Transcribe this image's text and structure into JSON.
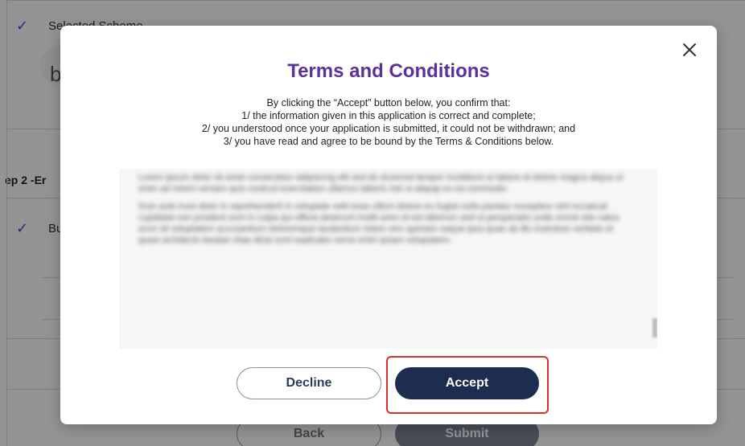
{
  "background": {
    "selected_scheme_label": "Selected Scheme",
    "logo_letter": "b",
    "step_title": "ep 2 -Er",
    "row_label": "Bu",
    "back_label": "Back",
    "submit_label": "Submit"
  },
  "modal": {
    "title": "Terms and Conditions",
    "intro_lines": [
      "By clicking the “Accept” button below, you confirm that:",
      "1/ the information given in this application is correct and complete;",
      "2/ you understood once your application is submitted, it could not be withdrawn; and",
      "3/ you have read and agree to be bound by the Terms & Conditions below."
    ],
    "terms_paragraphs": [
      "Lorem ipsum dolor sit amet consectetur adipiscing elit sed do eiusmod tempor incididunt ut labore et dolore magna aliqua ut enim ad minim veniam quis nostrud exercitation ullamco laboris nisi ut aliquip ex ea commodo.",
      "Duis aute irure dolor in reprehenderit in voluptate velit esse cillum dolore eu fugiat nulla pariatur excepteur sint occaecat cupidatat non proident sunt in culpa qui officia deserunt mollit anim id est laborum sed ut perspiciatis unde omnis iste natus error sit voluptatem accusantium doloremque laudantium totam rem aperiam eaque ipsa quae ab illo inventore veritatis et quasi architecto beatae vitae dicta sunt explicabo nemo enim ipsam voluptatem."
    ],
    "decline_label": "Decline",
    "accept_label": "Accept"
  },
  "colors": {
    "title": "#5b2f9e",
    "accept_bg": "#1d2d4f",
    "highlight": "#d9302b",
    "check": "#5b3fc1"
  },
  "icons": {
    "close": "close-icon",
    "check": "check-icon"
  }
}
